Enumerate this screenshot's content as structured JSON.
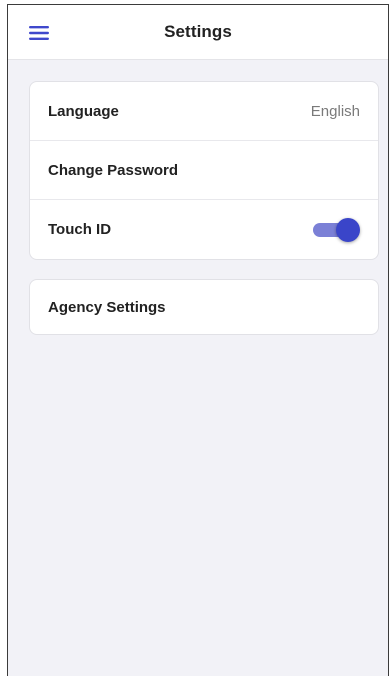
{
  "header": {
    "title": "Settings",
    "menu_icon": "hamburger-menu-icon"
  },
  "settings": {
    "language": {
      "label": "Language",
      "value": "English"
    },
    "change_password": {
      "label": "Change Password"
    },
    "touch_id": {
      "label": "Touch ID",
      "enabled": true
    }
  },
  "agency": {
    "label": "Agency Settings"
  },
  "colors": {
    "accent": "#3f48cc",
    "toggle_track_on": "#7b80d6",
    "toggle_thumb_on": "#3a45c9",
    "background": "#f2f2f7",
    "card": "#ffffff"
  }
}
